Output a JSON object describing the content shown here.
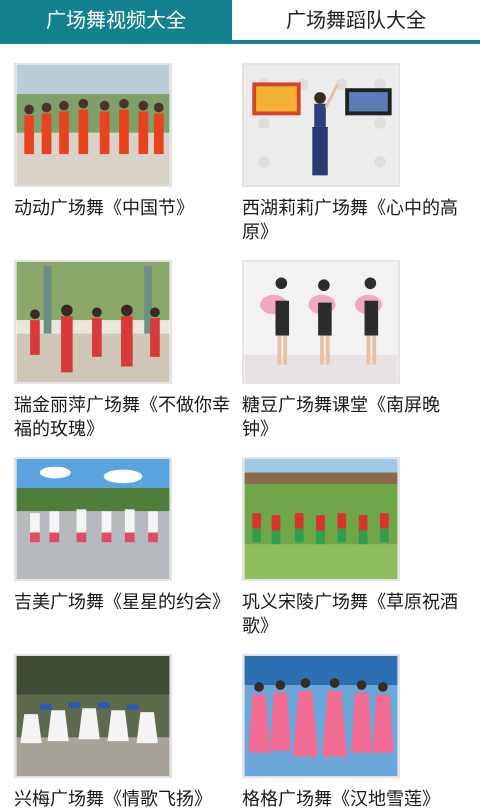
{
  "tabs": [
    {
      "label": "广场舞视频大全",
      "active": true
    },
    {
      "label": "广场舞蹈队大全",
      "active": false
    }
  ],
  "videos": [
    {
      "title": "动动广场舞《中国节》",
      "thumb_icon": "dance-group-red-costume"
    },
    {
      "title": "西湖莉莉广场舞《心中的高原》",
      "thumb_icon": "solo-dancer-stage"
    },
    {
      "title": "瑞金丽萍广场舞《不做你幸福的玫瑰》",
      "thumb_icon": "dance-group-park"
    },
    {
      "title": "糖豆广场舞课堂《南屏晚钟》",
      "thumb_icon": "trio-fan-dancers"
    },
    {
      "title": "吉美广场舞《星星的约会》",
      "thumb_icon": "dance-group-plaza"
    },
    {
      "title": "巩义宋陵广场舞《草原祝酒歌》",
      "thumb_icon": "dance-group-grassland"
    },
    {
      "title": "兴梅广场舞《情歌飞扬》",
      "thumb_icon": "dance-group-white-dress"
    },
    {
      "title": "格格广场舞《汉地雪莲》",
      "thumb_icon": "dance-group-pink-dress"
    }
  ],
  "colors": {
    "accent": "#14818f"
  }
}
